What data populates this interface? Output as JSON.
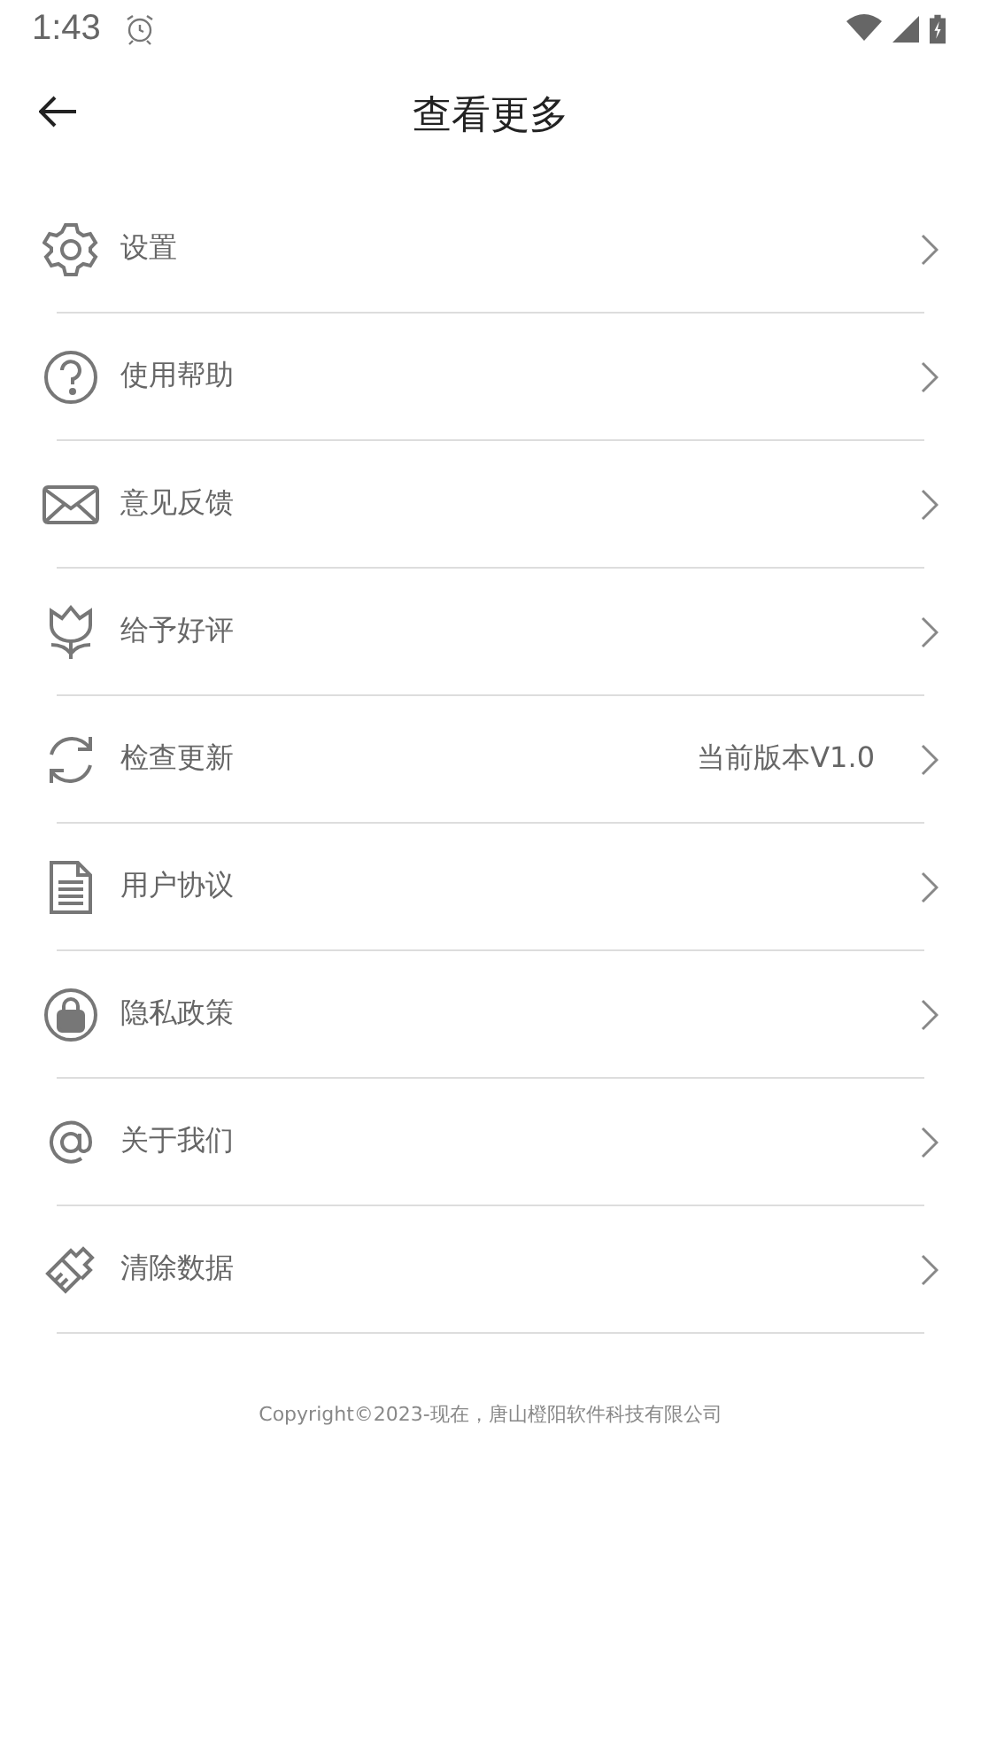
{
  "status_bar": {
    "time": "1:43"
  },
  "header": {
    "title": "查看更多"
  },
  "menu": [
    {
      "label": "设置"
    },
    {
      "label": "使用帮助"
    },
    {
      "label": "意见反馈"
    },
    {
      "label": "给予好评"
    },
    {
      "label": "检查更新",
      "detail": "当前版本V1.0"
    },
    {
      "label": "用户协议"
    },
    {
      "label": "隐私政策"
    },
    {
      "label": "关于我们"
    },
    {
      "label": "清除数据"
    }
  ],
  "footer": {
    "copyright": "Copyright©2023-现在，唐山橙阳软件科技有限公司"
  }
}
